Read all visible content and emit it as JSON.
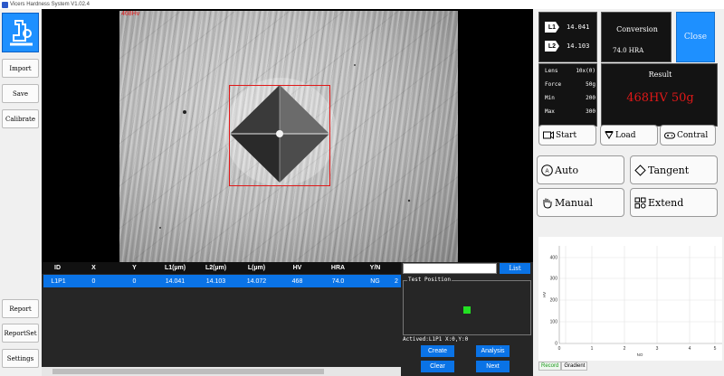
{
  "window": {
    "title": "Vicers Hardness System V1.02.4"
  },
  "left_toolbar": {
    "import": "Import",
    "save": "Save",
    "calibrate": "Calibrate",
    "report": "Report",
    "report_set": "ReportSet",
    "settings": "Settings"
  },
  "image": {
    "overlay_label": "468Hv"
  },
  "table": {
    "columns": [
      "ID",
      "X",
      "Y",
      "L1(µm)",
      "L2(µm)",
      "L(µm)",
      "HV",
      "HRA",
      "Y/N"
    ],
    "row": [
      "L1P1",
      "0",
      "0",
      "14.041",
      "14.103",
      "14.072",
      "468",
      "74.0",
      "NG"
    ],
    "row_extra": "2"
  },
  "list_panel": {
    "list_button": "List",
    "test_position_label": "Test Position",
    "actived_text": "Actived:L1P1 X:0,Y:0",
    "create": "Create",
    "analysis": "Analysis",
    "clear": "Clear",
    "next": "Next"
  },
  "measure": {
    "l1_tag": "L1",
    "l1_value": "14.041",
    "l2_tag": "L2",
    "l2_value": "14.103",
    "conversion_title": "Conversion",
    "conversion_value": "74.0  HRA",
    "close": "Close"
  },
  "params": {
    "lens_label": "Lens",
    "lens_value": "10x(0)",
    "force_label": "Force",
    "force_value": "50g",
    "min_label": "Min",
    "min_value": "200",
    "max_label": "Max",
    "max_value": "300"
  },
  "result": {
    "title": "Result",
    "value": "468HV 50g"
  },
  "controls": {
    "start": "Start",
    "load": "Load",
    "contral": "Contral",
    "auto": "Auto",
    "tangent": "Tangent",
    "manual": "Manual",
    "extend": "Extend"
  },
  "graph": {
    "y_label": "HV",
    "x_label": "NO",
    "y_ticks": [
      "0",
      "100",
      "200",
      "300",
      "400"
    ],
    "x_ticks": [
      "0",
      "1",
      "2",
      "3",
      "4",
      "5"
    ],
    "tabs": [
      "Record",
      "Gradient"
    ]
  },
  "colors": {
    "accent": "#0a73e6",
    "result_red": "#e01818",
    "marker_green": "#22e022",
    "dark_panel": "#131313"
  }
}
